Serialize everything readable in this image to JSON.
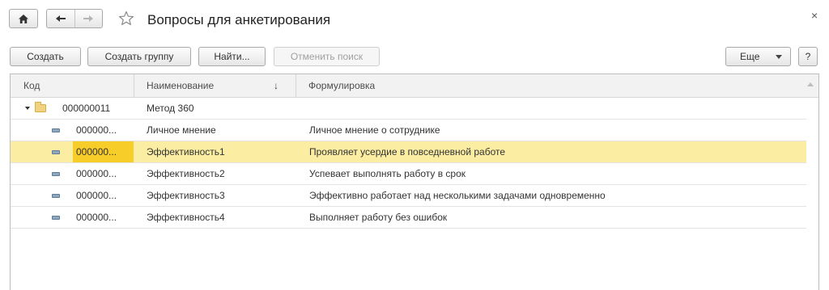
{
  "header": {
    "title": "Вопросы для анкетирования",
    "close": "×"
  },
  "toolbar": {
    "create": "Создать",
    "create_group": "Создать группу",
    "find": "Найти...",
    "cancel_search": "Отменить поиск",
    "more": "Еще",
    "help": "?"
  },
  "table": {
    "columns": {
      "code": "Код",
      "name": "Наименование",
      "formulation": "Формулировка",
      "sort_indicator": "↓"
    },
    "group": {
      "code": "000000011",
      "name": "Метод 360"
    },
    "rows": [
      {
        "code": "000000...",
        "name": "Личное мнение",
        "formulation": "Личное мнение о сотруднике"
      },
      {
        "code": "000000...",
        "name": "Эффективность1",
        "formulation": "Проявляет усердие в повседневной работе"
      },
      {
        "code": "000000...",
        "name": "Эффективность2",
        "formulation": "Успевает выполнять работу в срок"
      },
      {
        "code": "000000...",
        "name": "Эффективность3",
        "formulation": "Эффективно работает над несколькими задачами одновременно"
      },
      {
        "code": "000000...",
        "name": "Эффективность4",
        "formulation": "Выполняет работу без ошибок"
      }
    ],
    "selected_row": 1
  },
  "colors": {
    "selected_row": "#fbeda2",
    "selected_cell": "#f7cd2a",
    "folder": "#f1d281"
  },
  "icons": {
    "home": "home-icon",
    "back": "arrow-left-icon",
    "forward": "arrow-right-icon",
    "favorite": "star-icon",
    "folder": "folder-icon",
    "item": "item-icon"
  }
}
